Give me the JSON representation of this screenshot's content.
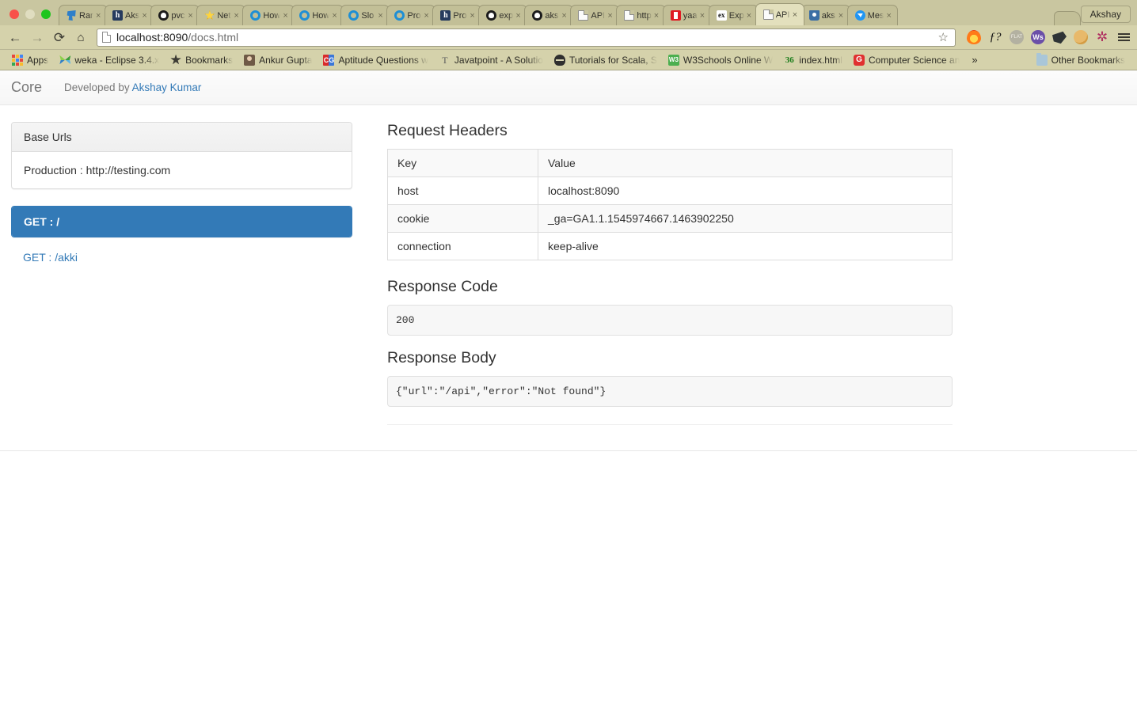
{
  "browser": {
    "window_controls": [
      "close",
      "minimize",
      "maximize"
    ],
    "profile_label": "Akshay",
    "tabs": [
      {
        "title": "Rar",
        "favicon": "app-icon",
        "active": false
      },
      {
        "title": "Aks",
        "favicon": "h-icon",
        "active": false
      },
      {
        "title": "pvc",
        "favicon": "github-icon",
        "active": false
      },
      {
        "title": "Net",
        "favicon": "star-icon",
        "active": false
      },
      {
        "title": "How",
        "favicon": "ring-icon",
        "active": false
      },
      {
        "title": "How",
        "favicon": "ring-icon",
        "active": false
      },
      {
        "title": "Slo",
        "favicon": "ring-icon",
        "active": false
      },
      {
        "title": "Pro",
        "favicon": "ring-icon",
        "active": false
      },
      {
        "title": "Pro",
        "favicon": "h-icon",
        "active": false
      },
      {
        "title": "exp",
        "favicon": "github-icon",
        "active": false
      },
      {
        "title": "aks",
        "favicon": "github-icon",
        "active": false
      },
      {
        "title": "API",
        "favicon": "document-icon",
        "active": false
      },
      {
        "title": "http",
        "favicon": "document-icon",
        "active": false
      },
      {
        "title": "yaa",
        "favicon": "red-icon",
        "active": false
      },
      {
        "title": "Exp",
        "favicon": "ex-icon",
        "active": false
      },
      {
        "title": "API",
        "favicon": "document-icon",
        "active": true
      },
      {
        "title": "aks",
        "favicon": "bucket-icon",
        "active": false
      },
      {
        "title": "Mes",
        "favicon": "messenger-icon",
        "active": false
      }
    ],
    "toolbar": {
      "back": "←",
      "forward": "→",
      "reload": "⟳",
      "home": "⌂",
      "url": "localhost:8090/docs.html",
      "url_host": "localhost:8090",
      "url_path": "/docs.html",
      "bookmark_star": "☆",
      "extensions": [
        "flame-icon",
        "function-question-icon",
        "flat-badge-icon",
        "ws-badge-icon",
        "dark-shape-icon",
        "cookie-icon",
        "asterisk-icon",
        "hamburger-menu-icon"
      ]
    },
    "bookmarks": [
      {
        "label": "Apps",
        "icon": "apps-grid-icon"
      },
      {
        "label": "weka - Eclipse 3.4.x",
        "icon": "weka-icon"
      },
      {
        "label": "Bookmarks",
        "icon": "star-icon"
      },
      {
        "label": "Ankur Gupta",
        "icon": "person-icon"
      },
      {
        "label": "Aptitude Questions w",
        "icon": "cg-icon"
      },
      {
        "label": "Javatpoint - A Solutio",
        "icon": "t-icon"
      },
      {
        "label": "Tutorials for Scala, S",
        "icon": "scala-icon"
      },
      {
        "label": "W3Schools Online W",
        "icon": "w3schools-icon"
      },
      {
        "label": "index.html",
        "icon": "36-icon"
      },
      {
        "label": "Computer Science an",
        "icon": "g-icon"
      }
    ],
    "bookmarks_overflow": "»",
    "other_bookmarks": {
      "label": "Other Bookmarks",
      "icon": "folder-icon"
    }
  },
  "page": {
    "navbar": {
      "brand": "Core",
      "byline_prefix": "Developed by ",
      "byline_link": "Akshay Kumar"
    },
    "sidebar": {
      "base_urls_panel": {
        "heading": "Base Urls",
        "entries": [
          "Production : http://testing.com"
        ]
      },
      "routes": [
        {
          "label": "GET : /",
          "active": true
        },
        {
          "label": "GET : /akki",
          "active": false
        }
      ]
    },
    "details": {
      "request_headers": {
        "title": "Request Headers",
        "columns": [
          "Key",
          "Value"
        ],
        "rows": [
          [
            "host",
            "localhost:8090"
          ],
          [
            "cookie",
            "_ga=GA1.1.1545974667.1463902250"
          ],
          [
            "connection",
            "keep-alive"
          ]
        ]
      },
      "response_code": {
        "title": "Response Code",
        "value": "200"
      },
      "response_body": {
        "title": "Response Body",
        "value": "{\"url\":\"/api\",\"error\":\"Not found\"}"
      }
    },
    "colors": {
      "primary": "#337ab7",
      "link": "#337ab7",
      "panel_border": "#dddddd",
      "code_bg": "#f7f7f7"
    }
  }
}
